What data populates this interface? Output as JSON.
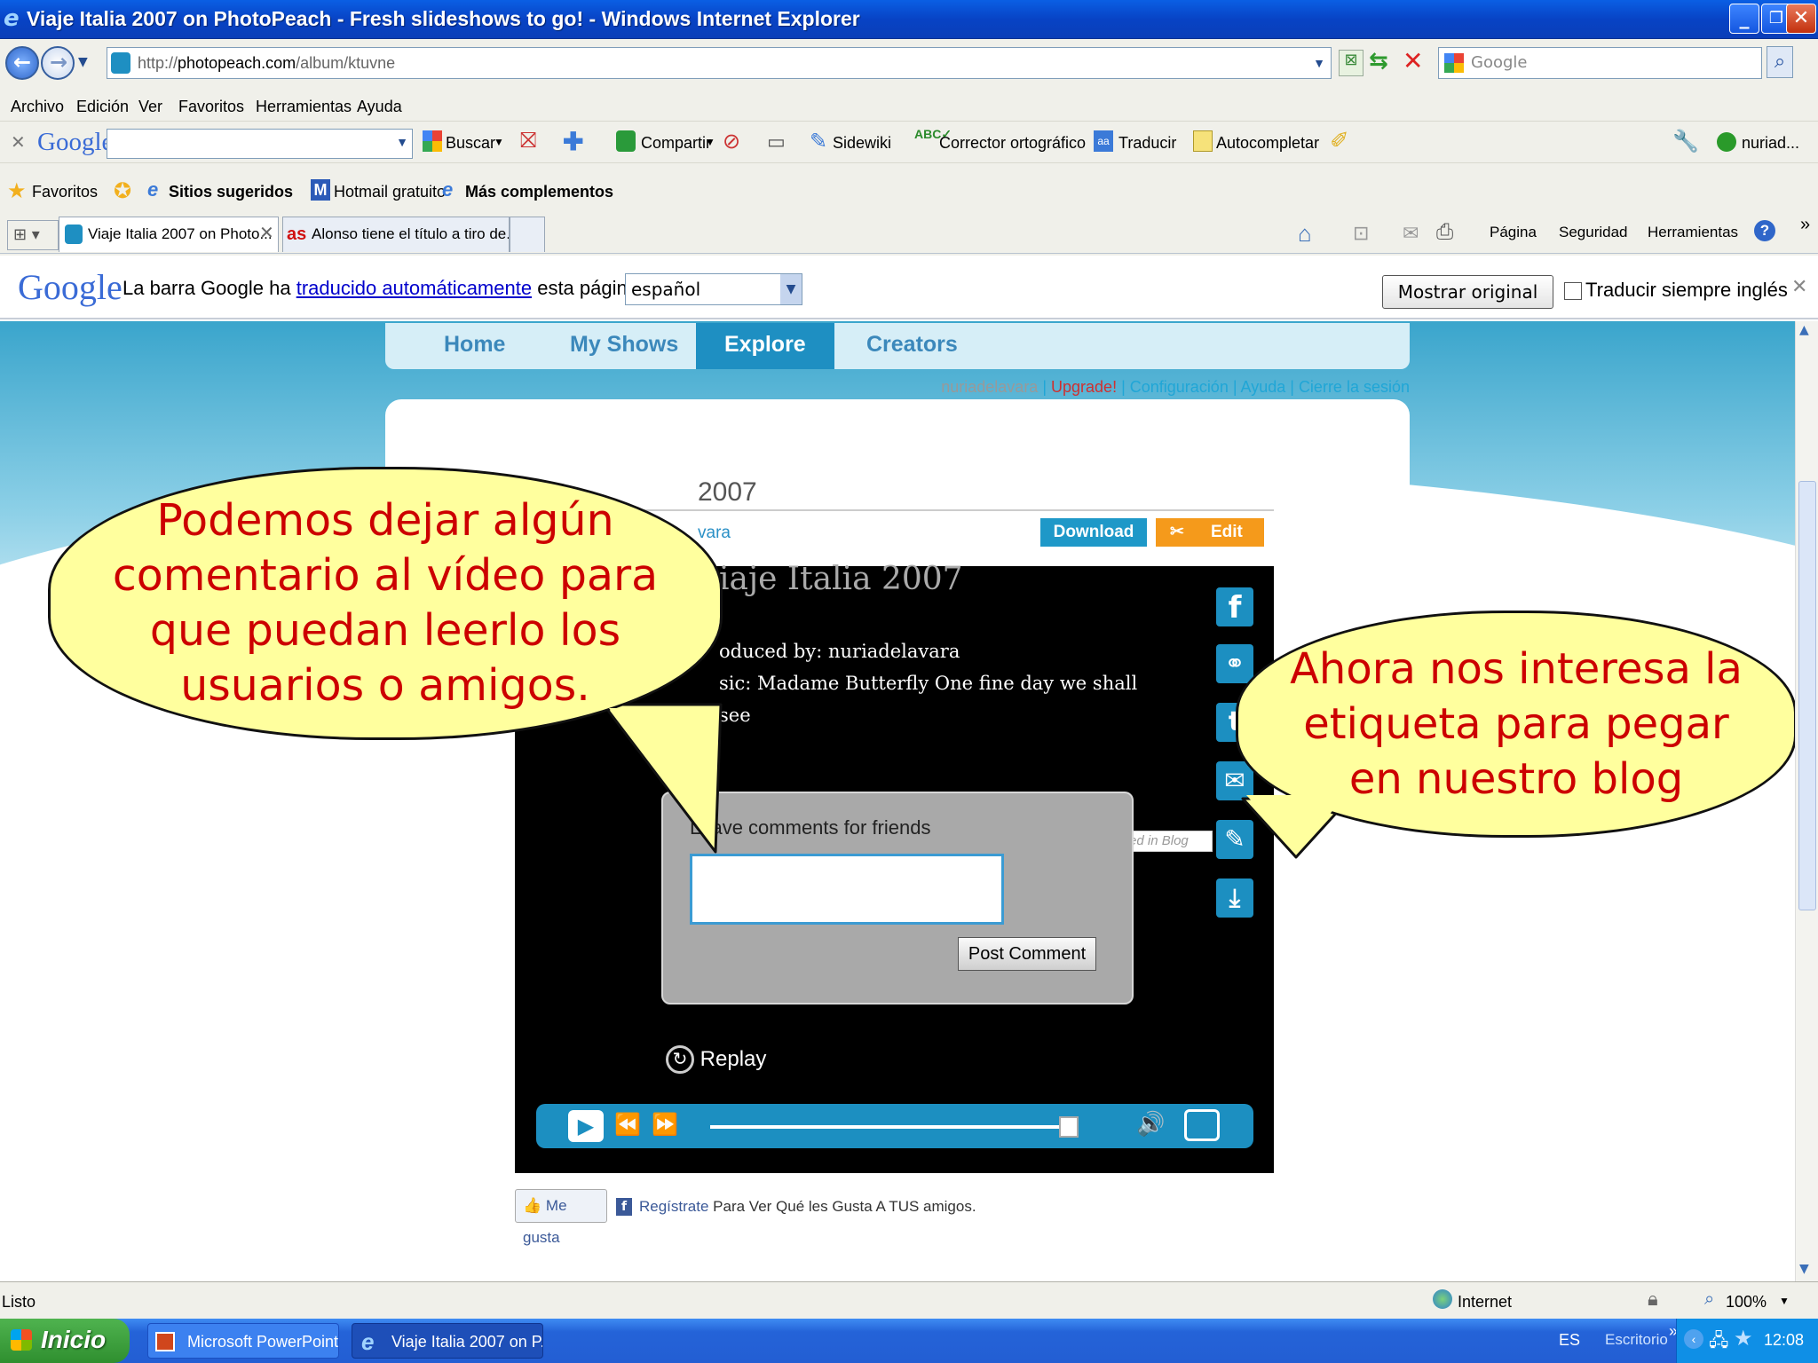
{
  "window": {
    "title": "Viaje Italia 2007 on PhotoPeach - Fresh slideshows to go! - Windows Internet Explorer"
  },
  "addressbar": {
    "url_prefix": "http://",
    "url_domain": "photopeach.com",
    "url_path": "/album/ktuvne",
    "search_placeholder": "Google"
  },
  "menu": [
    "Archivo",
    "Edición",
    "Ver",
    "Favoritos",
    "Herramientas",
    "Ayuda"
  ],
  "google_toolbar": {
    "logo": "Google",
    "buscar": "Buscar",
    "compartir": "Compartir",
    "sidewiki": "Sidewiki",
    "corrector": "Corrector ortográfico",
    "traducir": "Traducir",
    "autocompletar": "Autocompletar",
    "user": "nuriad..."
  },
  "favorites_bar": {
    "favoritos": "Favoritos",
    "sugeridos": "Sitios sugeridos",
    "hotmail": "Hotmail gratuito",
    "complementos": "Más complementos"
  },
  "tabs": [
    "Viaje Italia 2007 on Photo...",
    "Alonso tiene el título a tiro de..."
  ],
  "command_bar": {
    "pagina": "Página",
    "seguridad": "Seguridad",
    "herramientas": "Herramientas"
  },
  "translate_bar": {
    "logo": "Google",
    "text_before": "La barra Google ha",
    "link": "traducido automáticamente",
    "text_after": "esta página al",
    "language": "español",
    "show_original": "Mostrar original",
    "always_translate": "Traducir siempre inglés"
  },
  "site": {
    "nav": [
      "Home",
      "My Shows",
      "Explore",
      "Creators"
    ],
    "user": "nuriadelavara",
    "upgrade": "Upgrade!",
    "config": "Configuración",
    "help": "Ayuda",
    "logout": "Cierre la sesión",
    "album_title_visible": "2007",
    "author_visible": "vara",
    "download": "Download",
    "edit": "Edit"
  },
  "player": {
    "slide_title_visible": "iaje Italia 2007",
    "produced_visible": "oduced by: nuriadelavara",
    "music_visible": "sic: Madame Butterfly One fine day we shall",
    "music_line2_visible": "see",
    "comment_label": "Leave comments for friends",
    "post_button": "Post Comment",
    "embed_tooltip": "Embed in Blog",
    "replay": "Replay",
    "progress": 0.98
  },
  "social": {
    "like": "Me gusta",
    "register": "Regístrate",
    "register_rest": "Para Ver Qué les Gusta A TUS amigos."
  },
  "callouts": {
    "left": "Podemos dejar algún comentario al vídeo para que puedan leerlo los usuarios o amigos.",
    "right": "Ahora nos interesa la etiqueta para pegar en nuestro blog"
  },
  "statusbar": {
    "status": "Listo",
    "zone": "Internet",
    "zoom": "100%"
  },
  "taskbar": {
    "start": "Inicio",
    "items": [
      "Microsoft PowerPoint ...",
      "Viaje Italia 2007 on P..."
    ],
    "lang": "ES",
    "desktop": "Escritorio",
    "clock": "12:08"
  },
  "colors": {
    "accent": "#1e8fc2",
    "callout_bg": "#ffff9e",
    "callout_text": "#cc0000",
    "edit_orange": "#f59a1b"
  }
}
